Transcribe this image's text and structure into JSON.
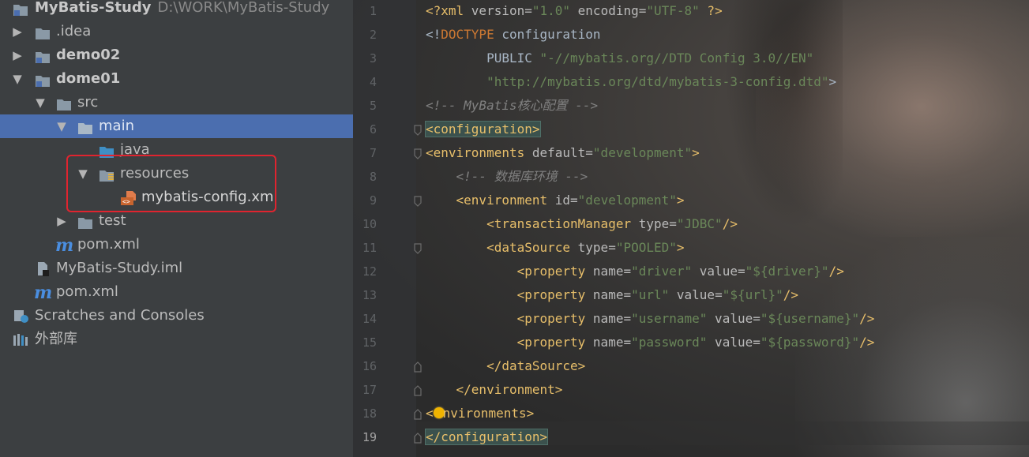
{
  "project_tree": {
    "root": {
      "name": "MyBatis-Study",
      "path": "D:\\WORK\\MyBatis-Study"
    },
    "items": [
      {
        "label": ".idea"
      },
      {
        "label": "demo02"
      },
      {
        "label": "dome01"
      },
      {
        "label": "src"
      },
      {
        "label": "main"
      },
      {
        "label": "java"
      },
      {
        "label": "resources"
      },
      {
        "label": "mybatis-config.xml"
      },
      {
        "label": "test"
      },
      {
        "label": "pom.xml"
      },
      {
        "label": "MyBatis-Study.iml"
      },
      {
        "label": "pom.xml"
      },
      {
        "label": "Scratches and Consoles"
      },
      {
        "label": "外部库"
      }
    ],
    "maven_glyph": "m",
    "selected_item": "main",
    "highlight_color": "#e0242f"
  },
  "editor": {
    "current_line": 19,
    "lines": [
      {
        "n": "1",
        "parts": [
          [
            "pi",
            "<?xml "
          ],
          [
            "attr",
            "version="
          ],
          [
            "val",
            "\"1.0\""
          ],
          [
            "attr",
            " encoding="
          ],
          [
            "val",
            "\"UTF-8\""
          ],
          [
            "pi",
            " ?>"
          ]
        ]
      },
      {
        "n": "2",
        "parts": [
          [
            "plain",
            "<!"
          ],
          [
            "kw",
            "DOCTYPE"
          ],
          [
            "plain",
            " configuration"
          ]
        ]
      },
      {
        "n": "3",
        "parts": [
          [
            "plain",
            "        PUBLIC "
          ],
          [
            "val",
            "\"-//mybatis.org//DTD Config 3.0//EN\""
          ]
        ]
      },
      {
        "n": "4",
        "parts": [
          [
            "val",
            "        \"http://mybatis.org/dtd/mybatis-3-config.dtd\""
          ],
          [
            "plain",
            ">"
          ]
        ]
      },
      {
        "n": "5",
        "parts": [
          [
            "comment",
            "<!-- MyBatis核心配置 -->"
          ]
        ]
      },
      {
        "n": "6",
        "parts": [
          [
            "tagm",
            "<configuration>"
          ]
        ]
      },
      {
        "n": "7",
        "parts": [
          [
            "tag",
            "<environments "
          ],
          [
            "attr",
            "default="
          ],
          [
            "val",
            "\"development\""
          ],
          [
            "tag",
            ">"
          ]
        ]
      },
      {
        "n": "8",
        "parts": [
          [
            "comment",
            "    <!-- 数据库环境 -->"
          ]
        ]
      },
      {
        "n": "9",
        "parts": [
          [
            "tag",
            "    <environment "
          ],
          [
            "attr",
            "id="
          ],
          [
            "val",
            "\"development\""
          ],
          [
            "tag",
            ">"
          ]
        ]
      },
      {
        "n": "10",
        "parts": [
          [
            "tag",
            "        <transactionManager "
          ],
          [
            "attr",
            "type="
          ],
          [
            "val",
            "\"JDBC\""
          ],
          [
            "tag",
            "/>"
          ]
        ]
      },
      {
        "n": "11",
        "parts": [
          [
            "tag",
            "        <dataSource "
          ],
          [
            "attr",
            "type="
          ],
          [
            "val",
            "\"POOLED\""
          ],
          [
            "tag",
            ">"
          ]
        ]
      },
      {
        "n": "12",
        "parts": [
          [
            "tag",
            "            <property "
          ],
          [
            "attr",
            "name="
          ],
          [
            "val",
            "\"driver\""
          ],
          [
            "attr",
            " value="
          ],
          [
            "val",
            "\"${driver}\""
          ],
          [
            "tag",
            "/>"
          ]
        ]
      },
      {
        "n": "13",
        "parts": [
          [
            "tag",
            "            <property "
          ],
          [
            "attr",
            "name="
          ],
          [
            "val",
            "\"url\""
          ],
          [
            "attr",
            " value="
          ],
          [
            "val",
            "\"${url}\""
          ],
          [
            "tag",
            "/>"
          ]
        ]
      },
      {
        "n": "14",
        "parts": [
          [
            "tag",
            "            <property "
          ],
          [
            "attr",
            "name="
          ],
          [
            "val",
            "\"username\""
          ],
          [
            "attr",
            " value="
          ],
          [
            "val",
            "\"${username}\""
          ],
          [
            "tag",
            "/>"
          ]
        ]
      },
      {
        "n": "15",
        "parts": [
          [
            "tag",
            "            <property "
          ],
          [
            "attr",
            "name="
          ],
          [
            "val",
            "\"password\""
          ],
          [
            "attr",
            " value="
          ],
          [
            "val",
            "\"${password}\""
          ],
          [
            "tag",
            "/>"
          ]
        ]
      },
      {
        "n": "16",
        "parts": [
          [
            "tag",
            "        </dataSource>"
          ]
        ]
      },
      {
        "n": "17",
        "parts": [
          [
            "tag",
            "    </environment>"
          ]
        ]
      },
      {
        "n": "18",
        "parts": [
          [
            "tag",
            "<"
          ],
          [
            "bulb",
            ""
          ],
          [
            "tag",
            "nvironments>"
          ]
        ]
      },
      {
        "n": "19",
        "parts": [
          [
            "tagm",
            "</configuration>"
          ]
        ]
      }
    ],
    "colors": {
      "tag": "#e8bf6a",
      "attribute": "#bababa",
      "value": "#6a8759",
      "comment": "#808080",
      "keyword": "#cc7832"
    }
  }
}
